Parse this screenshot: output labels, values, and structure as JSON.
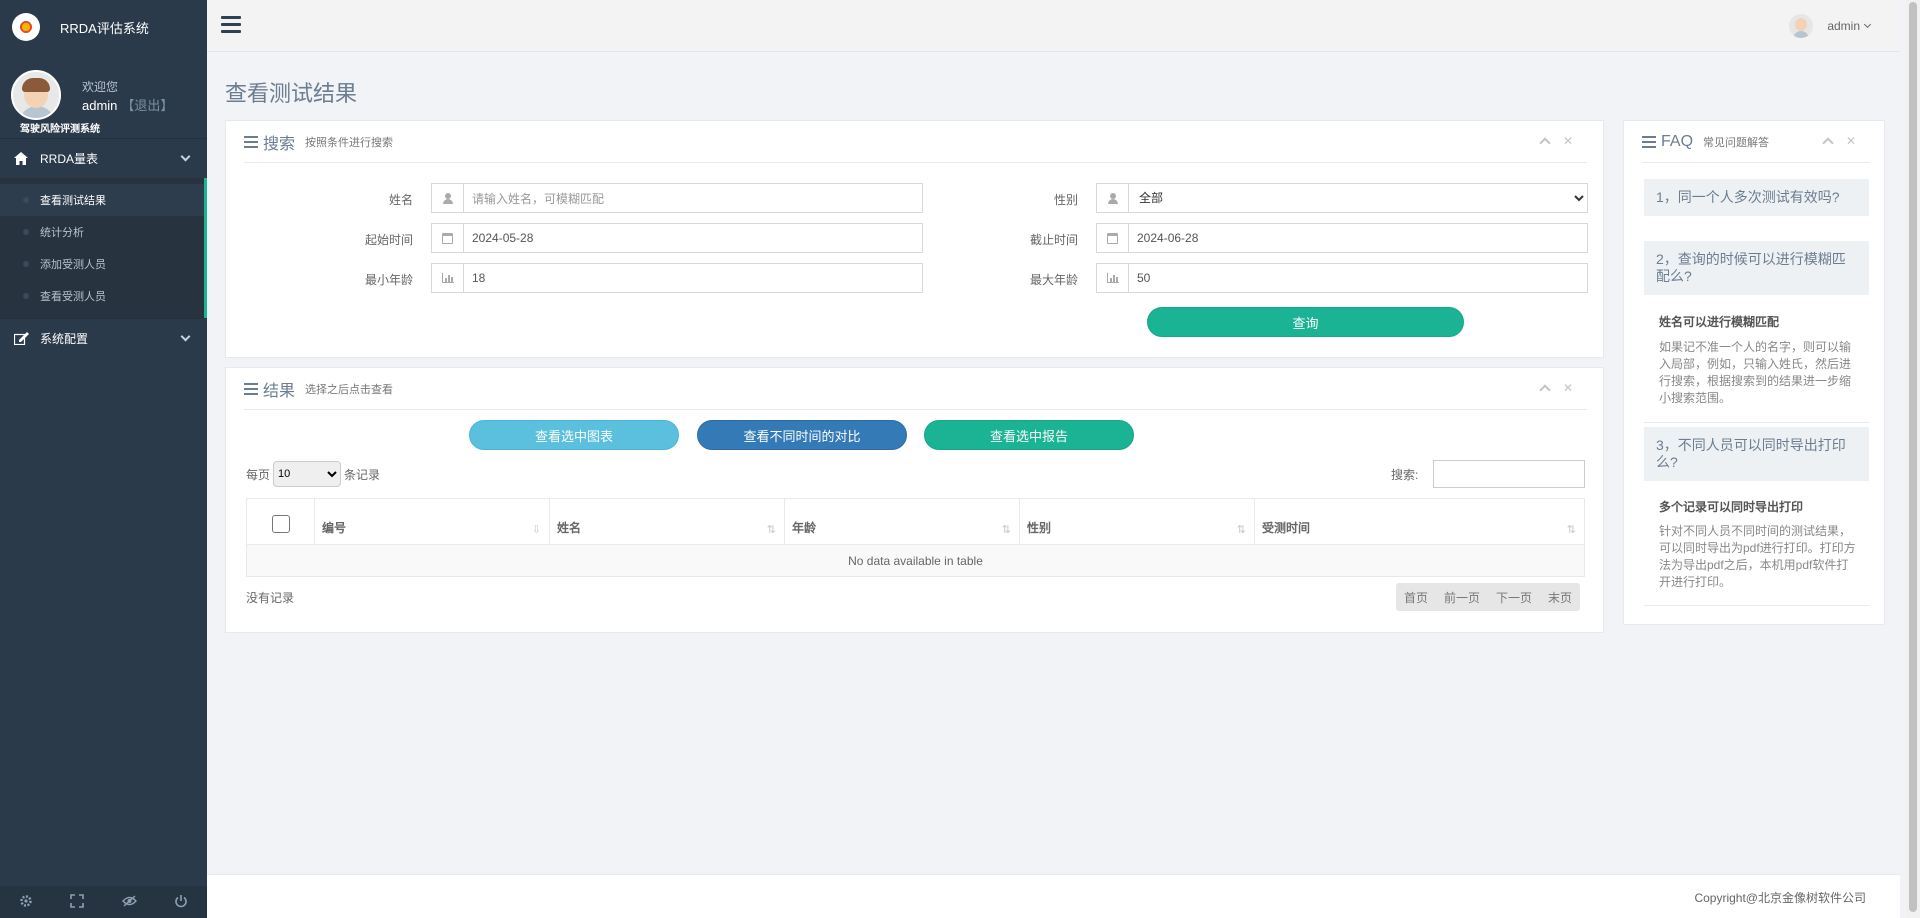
{
  "app": {
    "title": "RRDA评估系统"
  },
  "profile": {
    "welcome": "欢迎您",
    "username": "admin",
    "logout": "【退出】",
    "system": "驾驶风险评测系统"
  },
  "sidebar": {
    "groups": [
      {
        "label": "RRDA量表",
        "items": [
          "查看测试结果",
          "统计分析",
          "添加受测人员",
          "查看受测人员"
        ]
      },
      {
        "label": "系统配置"
      }
    ]
  },
  "topbar": {
    "user": "admin"
  },
  "page": {
    "title": "查看测试结果"
  },
  "search_panel": {
    "title": "搜索",
    "subtitle": "按照条件进行搜索",
    "fields": {
      "name": {
        "label": "姓名",
        "placeholder": "请输入姓名，可模糊匹配",
        "value": ""
      },
      "gender": {
        "label": "性别",
        "value": "全部"
      },
      "start": {
        "label": "起始时间",
        "value": "2024-05-28"
      },
      "end": {
        "label": "截止时间",
        "value": "2024-06-28"
      },
      "min_age": {
        "label": "最小年龄",
        "value": "18"
      },
      "max_age": {
        "label": "最大年龄",
        "value": "50"
      }
    },
    "query_button": "查询"
  },
  "results_panel": {
    "title": "结果",
    "subtitle": "选择之后点击查看",
    "buttons": {
      "chart": "查看选中图表",
      "compare": "查看不同时间的对比",
      "report": "查看选中报告"
    },
    "length": {
      "prefix": "每页",
      "value": "10",
      "suffix": "条记录"
    },
    "search_label": "搜索:",
    "columns": [
      "编号",
      "姓名",
      "年龄",
      "性别",
      "受测时间"
    ],
    "empty": "No data available in table",
    "info": "没有记录",
    "pager": [
      "首页",
      "前一页",
      "下一页",
      "末页"
    ]
  },
  "faq": {
    "title": "FAQ",
    "subtitle": "常见问题解答",
    "questions": [
      {
        "q": "1，同一个人多次测试有效吗?"
      },
      {
        "q": "2，查询的时候可以进行模糊匹配么?",
        "a_title": "姓名可以进行模糊匹配",
        "a_text": "如果记不准一个人的名字，则可以输入局部，例如，只输入姓氏，然后进行搜索，根据搜索到的结果进一步缩小搜索范围。"
      },
      {
        "q": "3，不同人员可以同时导出打印么?",
        "a_title": "多个记录可以同时导出打印",
        "a_text": "针对不同人员不同时间的测试结果，可以同时导出为pdf进行打印。打印方法为导出pdf之后，本机用pdf软件打开进行打印。"
      }
    ]
  },
  "footer": {
    "copyright": "Copyright@北京金像树软件公司"
  }
}
